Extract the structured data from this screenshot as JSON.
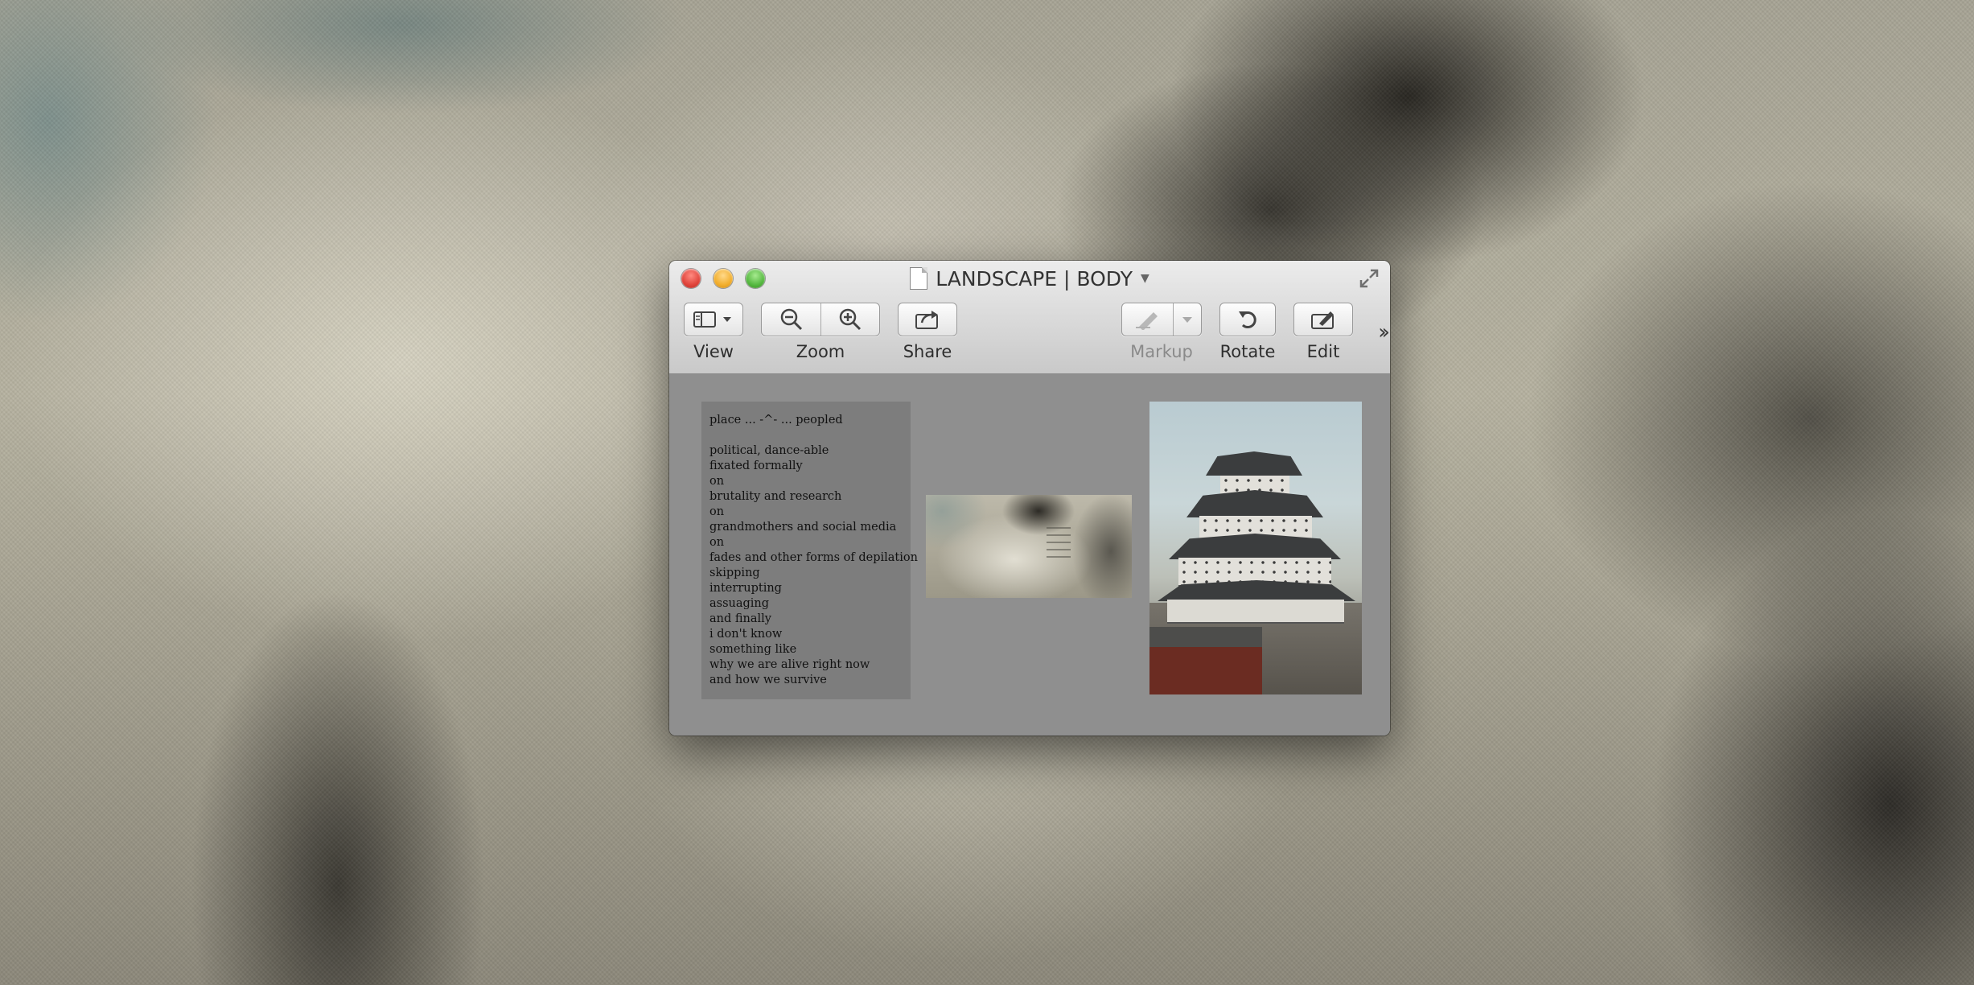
{
  "window": {
    "title": "LANDSCAPE | BODY",
    "document_icon": "document-icon",
    "title_menu_icon": "chevron-down-icon",
    "fullscreen_icon": "fullscreen-icon"
  },
  "toolbar": {
    "view_label": "View",
    "zoom_label": "Zoom",
    "share_label": "Share",
    "markup_label": "Markup",
    "rotate_label": "Rotate",
    "edit_label": "Edit",
    "more_icon": "double-chevron-right-icon",
    "markup_enabled": false
  },
  "pages": {
    "text_page": {
      "lines": [
        "place ... -^- ... peopled",
        "",
        "political, dance-able",
        "fixated formally",
        "on",
        "brutality and research",
        "on",
        "grandmothers and social media",
        "on",
        "fades and other forms of depilation",
        "skipping",
        "interrupting",
        "assuaging",
        "and finally",
        "i don't know",
        "something like",
        "why we are alive right now",
        "and how we survive"
      ]
    },
    "image_body": "torso-photo",
    "image_castle": "castle-photo"
  },
  "colors": {
    "close": "#e0443b",
    "minimize": "#f2ae2c",
    "zoom": "#55b840",
    "content_bg": "#8f8f8f",
    "text_page_bg": "#7d7d7d"
  }
}
